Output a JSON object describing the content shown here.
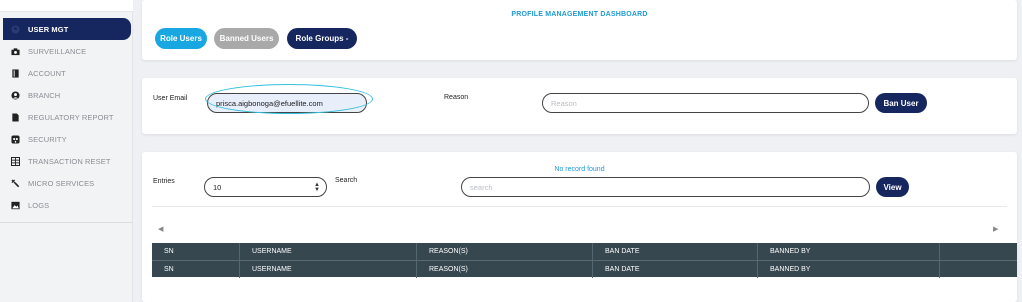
{
  "sidebar": {
    "items": [
      {
        "label": "USER MGT",
        "icon": "user-circle-icon",
        "active": true
      },
      {
        "label": "SURVEILLANCE",
        "icon": "camera-icon"
      },
      {
        "label": "ACCOUNT",
        "icon": "book-icon"
      },
      {
        "label": "BRANCH",
        "icon": "user-icon"
      },
      {
        "label": "REGULATORY REPORT",
        "icon": "document-icon"
      },
      {
        "label": "SECURITY",
        "icon": "skull-icon"
      },
      {
        "label": "TRANSACTION RESET",
        "icon": "grid-icon"
      },
      {
        "label": "MICRO SERVICES",
        "icon": "wrench-icon"
      },
      {
        "label": "LOGS",
        "icon": "image-icon"
      }
    ]
  },
  "header": {
    "title": "PROFILE MANAGEMENT DASHBOARD",
    "buttons": {
      "role_users": "Role Users",
      "banned_users": "Banned Users",
      "role_groups": "Role Groups -"
    }
  },
  "ban_form": {
    "email_label": "User Email",
    "email_value": "prisca.aigbonoga@efuellite.com",
    "reason_label": "Reason",
    "reason_placeholder": "Reason",
    "ban_button": "Ban User"
  },
  "list": {
    "entries_label": "Entries",
    "entries_value": "10",
    "search_label": "Search",
    "search_placeholder": "search",
    "view_button": "View",
    "no_record": "No record found",
    "columns": [
      "SN",
      "USERNAME",
      "REASON(S)",
      "BAN DATE",
      "BANNED BY",
      ""
    ],
    "footer_columns": [
      "SN",
      "USERNAME",
      "REASON(S)",
      "BAN DATE",
      "BANNED BY",
      ""
    ]
  },
  "colors": {
    "sidebar_active": "#16265e",
    "accent_blue": "#18a7e0",
    "title_blue": "#1f9ad6",
    "table_header": "#37474f"
  }
}
